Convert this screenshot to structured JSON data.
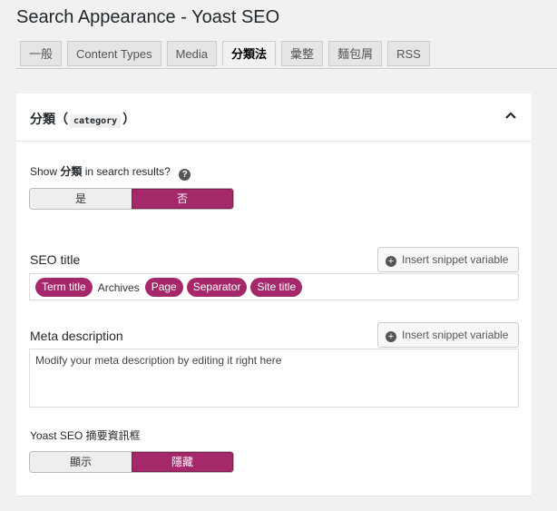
{
  "header": {
    "title": "Search Appearance - Yoast SEO"
  },
  "tabs": [
    {
      "label": "一般",
      "active": false
    },
    {
      "label": "Content Types",
      "active": false
    },
    {
      "label": "Media",
      "active": false
    },
    {
      "label": "分類法",
      "active": true
    },
    {
      "label": "彙整",
      "active": false
    },
    {
      "label": "麵包屑",
      "active": false
    },
    {
      "label": "RSS",
      "active": false
    }
  ],
  "section": {
    "title_prefix": "分類",
    "paren_open": "（",
    "code": "category",
    "paren_close": "）"
  },
  "show_in_results": {
    "prefix": "Show",
    "term": "分類",
    "suffix": "in search results?",
    "options": [
      "是",
      "否"
    ],
    "selected": "否"
  },
  "seo_title": {
    "label": "SEO title",
    "insert_label": "Insert snippet variable",
    "parts": [
      {
        "type": "pill",
        "text": "Term title"
      },
      {
        "type": "text",
        "text": "Archives"
      },
      {
        "type": "pill",
        "text": "Page"
      },
      {
        "type": "pill",
        "text": "Separator"
      },
      {
        "type": "pill",
        "text": "Site title"
      }
    ]
  },
  "meta_description": {
    "label": "Meta description",
    "insert_label": "Insert snippet variable",
    "placeholder": "Modify your meta description by editing it right here"
  },
  "metabox": {
    "label": "Yoast SEO 摘要資訊框",
    "options": [
      "顯示",
      "隱藏"
    ],
    "selected": "隱藏"
  },
  "colors": {
    "accent": "#a4286a",
    "background": "#f1f1f1"
  }
}
